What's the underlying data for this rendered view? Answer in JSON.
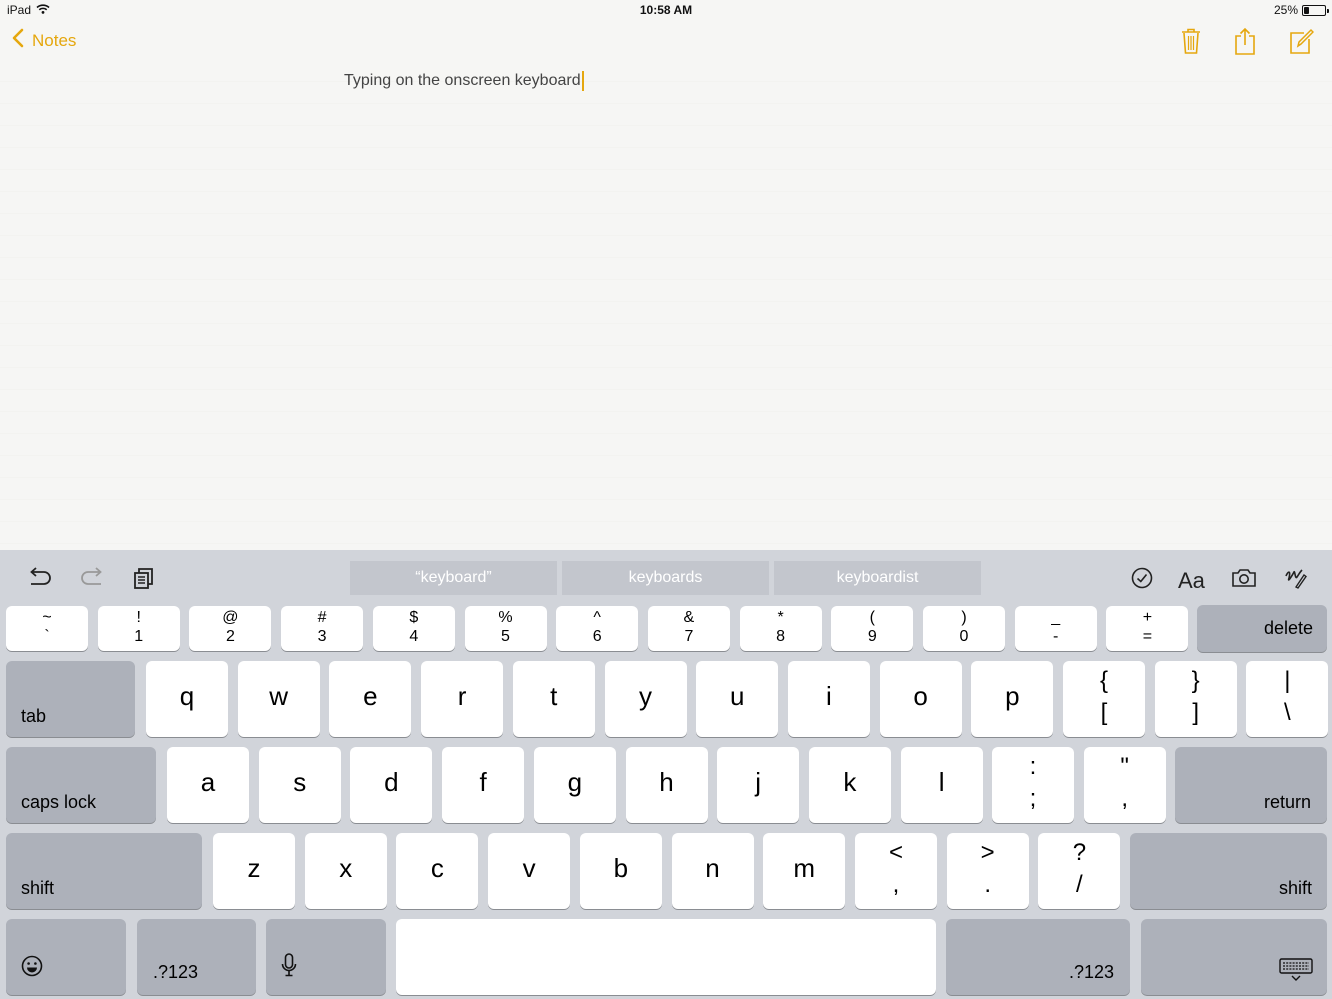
{
  "status_bar": {
    "device": "iPad",
    "time": "10:58 AM",
    "battery": "25%",
    "battery_level": 0.25
  },
  "nav": {
    "back_label": "Notes",
    "icons": [
      "trash-icon",
      "share-icon",
      "compose-icon"
    ],
    "accent_color": "#e5a70e"
  },
  "note": {
    "text": "Typing on the onscreen keyboard"
  },
  "shortcut_bar": {
    "left_icons": [
      "undo-icon",
      "redo-icon",
      "paste-icon"
    ],
    "suggestions": [
      "“keyboard”",
      "keyboards",
      "keyboardist"
    ],
    "right_icons": [
      "checklist-icon",
      "format-text-icon",
      "camera-icon",
      "sketch-icon"
    ],
    "format_glyph": "Aa"
  },
  "keyboard": {
    "number_row": [
      {
        "top": "~",
        "bottom": "`"
      },
      {
        "top": "!",
        "bottom": "1"
      },
      {
        "top": "@",
        "bottom": "2"
      },
      {
        "top": "#",
        "bottom": "3"
      },
      {
        "top": "$",
        "bottom": "4"
      },
      {
        "top": "%",
        "bottom": "5"
      },
      {
        "top": "^",
        "bottom": "6"
      },
      {
        "top": "&",
        "bottom": "7"
      },
      {
        "top": "*",
        "bottom": "8"
      },
      {
        "top": "(",
        "bottom": "9"
      },
      {
        "top": ")",
        "bottom": "0"
      },
      {
        "top": "_",
        "bottom": "-"
      },
      {
        "top": "+",
        "bottom": "="
      }
    ],
    "delete_label": "delete",
    "tab_label": "tab",
    "row_q": [
      "q",
      "w",
      "e",
      "r",
      "t",
      "y",
      "u",
      "i",
      "o",
      "p"
    ],
    "row_q_symbols": [
      {
        "top": "{",
        "bottom": "["
      },
      {
        "top": "}",
        "bottom": "]"
      },
      {
        "top": "|",
        "bottom": "\\"
      }
    ],
    "caps_lock_label": "caps lock",
    "row_a": [
      "a",
      "s",
      "d",
      "f",
      "g",
      "h",
      "j",
      "k",
      "l"
    ],
    "row_a_symbols": [
      {
        "top": ":",
        "bottom": ";"
      },
      {
        "top": "\"",
        "bottom": ","
      }
    ],
    "return_label": "return",
    "shift_label": "shift",
    "row_z": [
      "z",
      "x",
      "c",
      "v",
      "b",
      "n",
      "m"
    ],
    "row_z_symbols": [
      {
        "top": "<",
        "bottom": ","
      },
      {
        "top": ">",
        "bottom": "."
      },
      {
        "top": "?",
        "bottom": "/"
      }
    ],
    "numbers_label": ".?123",
    "bottom_icons": [
      "emoji-icon",
      "microphone-icon",
      "hide-keyboard-icon"
    ]
  }
}
